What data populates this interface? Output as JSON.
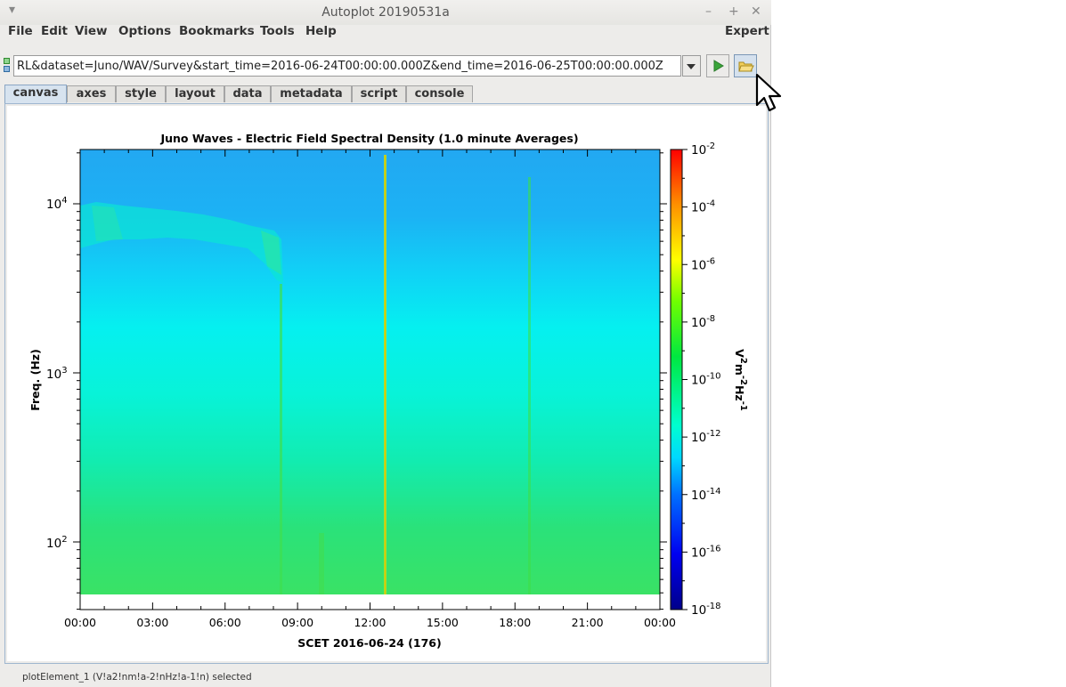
{
  "window": {
    "title": "Autoplot 20190531a"
  },
  "menubar": {
    "items": [
      "File",
      "Edit",
      "View",
      "Options",
      "Bookmarks",
      "Tools",
      "Help"
    ],
    "expert": "Expert"
  },
  "toolbar": {
    "url": "RL&dataset=Juno/WAV/Survey&start_time=2016-06-24T00:00:00.000Z&end_time=2016-06-25T00:00:00.000Z",
    "icons": [
      "chevron-down-icon",
      "play-icon",
      "open-folder-icon"
    ]
  },
  "tabs": [
    "canvas",
    "axes",
    "style",
    "layout",
    "data",
    "metadata",
    "script",
    "console"
  ],
  "active_tab": "canvas",
  "plot": {
    "title": "Juno Waves - Electric Field Spectral Density (1.0 minute Averages)",
    "xlabel": "SCET 2016-06-24 (176)",
    "ylabel": "Freq. (Hz)",
    "xticks": [
      "00:00",
      "03:00",
      "06:00",
      "09:00",
      "12:00",
      "15:00",
      "18:00",
      "21:00",
      "00:00"
    ],
    "yticks": [
      {
        "base": "10",
        "exp": "4"
      },
      {
        "base": "10",
        "exp": "3"
      },
      {
        "base": "10",
        "exp": "2"
      }
    ],
    "colorbar_ticks": [
      {
        "base": "10",
        "exp": "-2"
      },
      {
        "base": "10",
        "exp": "-4"
      },
      {
        "base": "10",
        "exp": "-6"
      },
      {
        "base": "10",
        "exp": "-8"
      },
      {
        "base": "10",
        "exp": "-10"
      },
      {
        "base": "10",
        "exp": "-12"
      },
      {
        "base": "10",
        "exp": "-14"
      },
      {
        "base": "10",
        "exp": "-16"
      },
      {
        "base": "10",
        "exp": "-18"
      }
    ],
    "colorbar_label": {
      "v": "V",
      "e1": "2",
      "m": "m",
      "e2": "-2",
      "hz": "Hz",
      "e3": "-1"
    }
  },
  "status": "plotElement_1 (V!a2!nm!a-2!nHz!a-1!n) selected",
  "colors": {
    "spectrogram_top": "#1ea5f0",
    "spectrogram_mid": "#05f5ef",
    "spectrogram_bottom": "#36e55a"
  }
}
